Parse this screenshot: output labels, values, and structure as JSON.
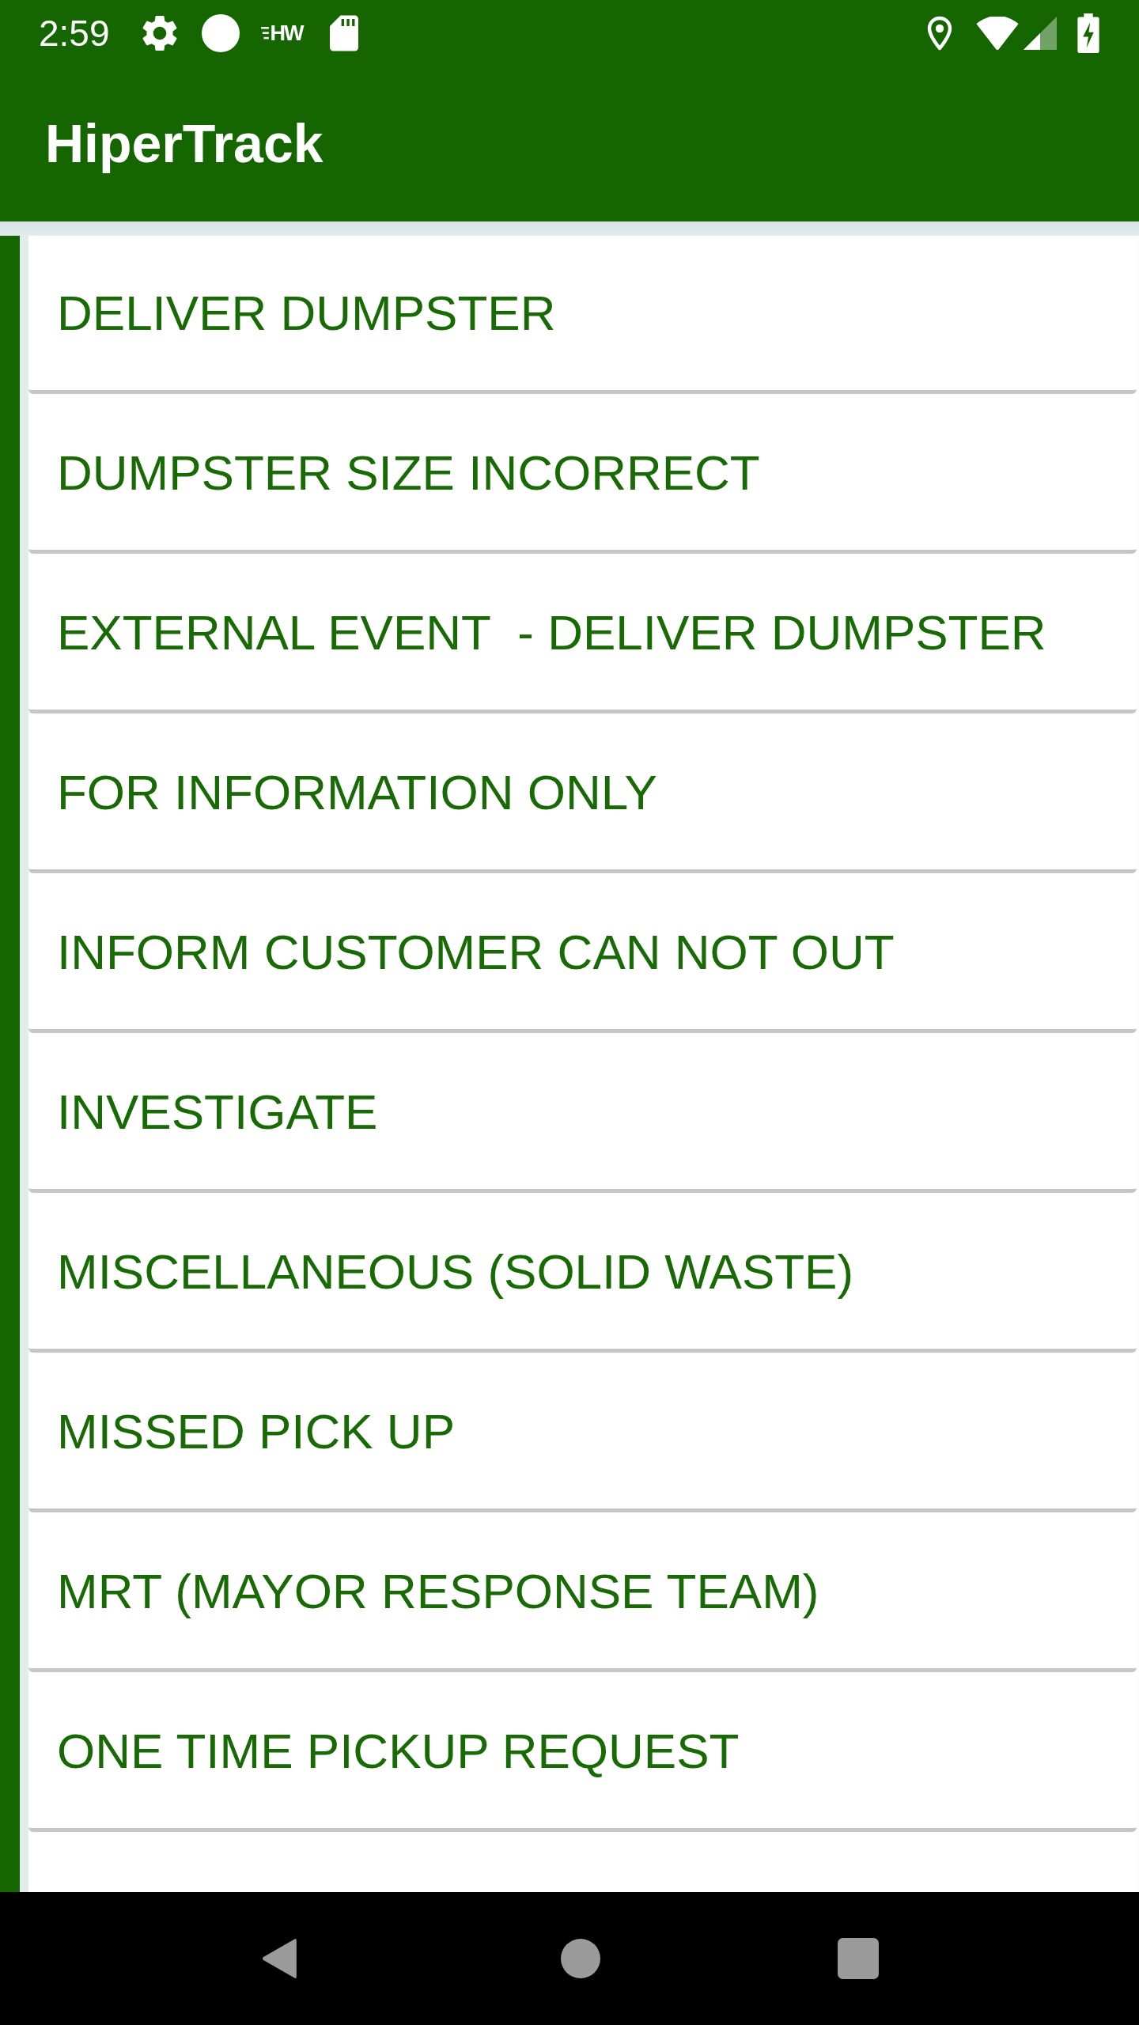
{
  "status_bar": {
    "time": "2:59",
    "notification_label": "HW"
  },
  "app_bar": {
    "title": "HiperTrack"
  },
  "items": [
    "DELIVER DUMPSTER",
    "DUMPSTER SIZE INCORRECT",
    "EXTERNAL EVENT  - DELIVER DUMPSTER",
    "FOR INFORMATION ONLY",
    "INFORM CUSTOMER CAN NOT OUT",
    "INVESTIGATE",
    "MISCELLANEOUS (SOLID WASTE)",
    "MISSED PICK UP",
    "MRT (MAYOR RESPONSE TEAM)",
    "ONE TIME PICKUP REQUEST"
  ]
}
